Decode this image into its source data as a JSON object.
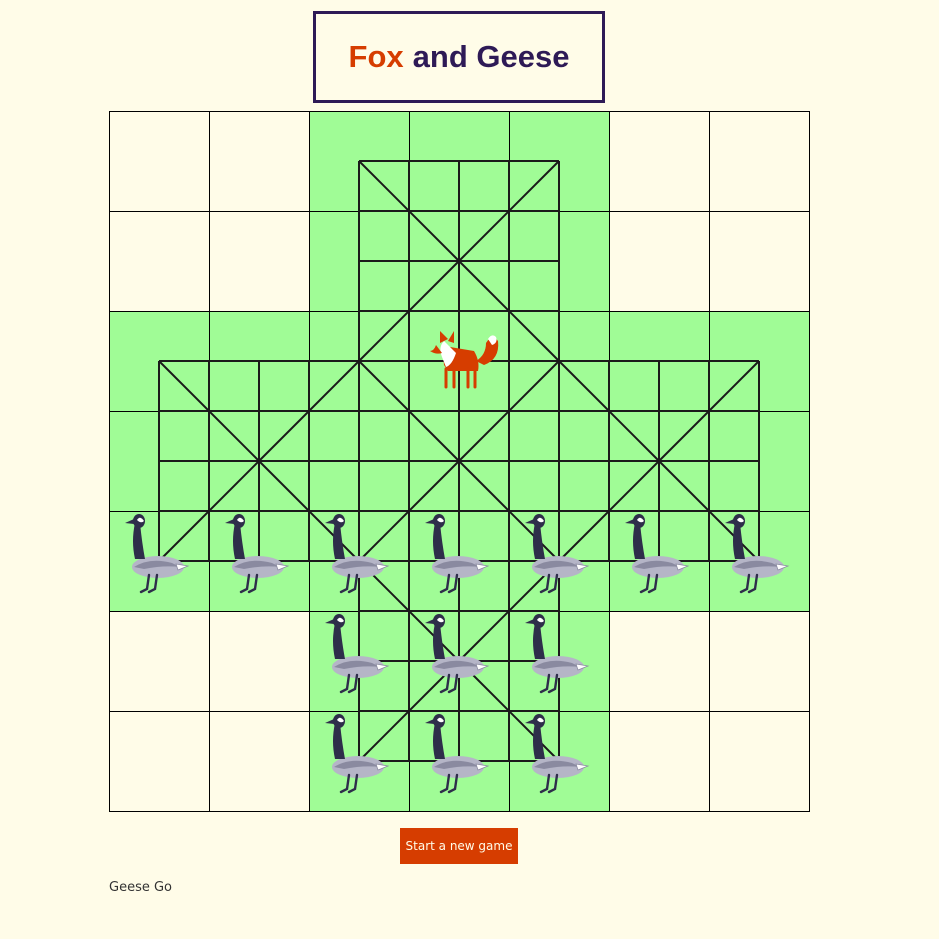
{
  "title": {
    "fox": "Fox",
    "rest": "and Geese"
  },
  "board": {
    "grid_size": 7,
    "colors": {
      "active_cell": "#a0fc96",
      "inactive_cell": "#fffce8",
      "cell_border": "#000000",
      "line": "#1a1a1a",
      "fox": "#d63d00",
      "goose_neck": "#2e2e4a",
      "goose_body": "#b5b5c7"
    },
    "pieces": {
      "fox": [
        [
          3,
          2
        ]
      ],
      "geese": [
        [
          0,
          4
        ],
        [
          1,
          4
        ],
        [
          2,
          4
        ],
        [
          3,
          4
        ],
        [
          4,
          4
        ],
        [
          5,
          4
        ],
        [
          6,
          4
        ],
        [
          2,
          5
        ],
        [
          3,
          5
        ],
        [
          4,
          5
        ],
        [
          2,
          6
        ],
        [
          3,
          6
        ],
        [
          4,
          6
        ]
      ]
    }
  },
  "new_game_button": {
    "label": "Start a new game"
  },
  "status": {
    "text": "Geese Go"
  }
}
